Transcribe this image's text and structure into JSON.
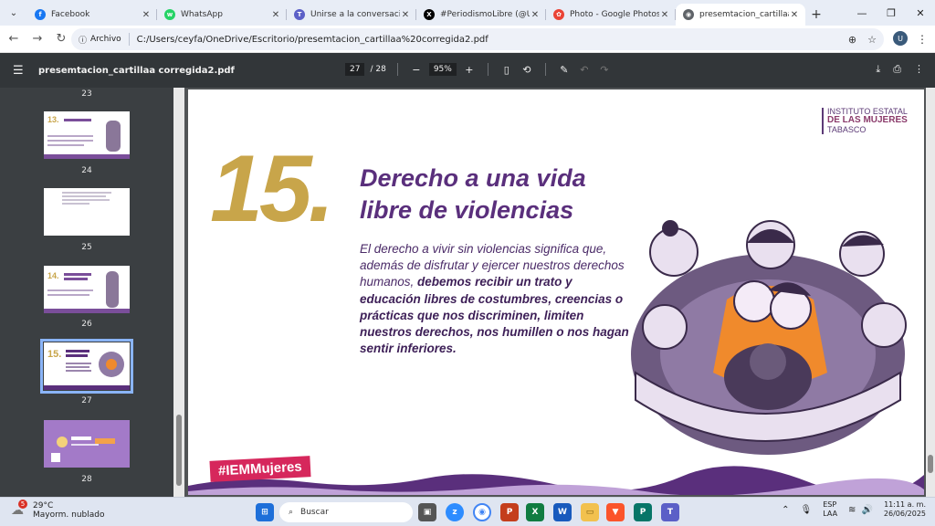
{
  "tabs": [
    {
      "title": "Facebook",
      "color": "#1877f2",
      "glyph": "f"
    },
    {
      "title": "WhatsApp",
      "color": "#25d366",
      "glyph": "w"
    },
    {
      "title": "Unirse a la conversación",
      "color": "#5b5fc7",
      "glyph": "T"
    },
    {
      "title": "#PeriodismoLibre (@UrielK",
      "color": "#000000",
      "glyph": "X"
    },
    {
      "title": "Photo - Google Photos",
      "color": "#ea4335",
      "glyph": "✿"
    },
    {
      "title": "presemtacion_cartillaa cor",
      "color": "#5f6368",
      "glyph": "◉",
      "active": true
    }
  ],
  "address": {
    "chip": "Archivo",
    "url": "C:/Users/ceyfa/OneDrive/Escritorio/presemtacion_cartillaa%20corregida2.pdf",
    "avatar": "U"
  },
  "pdf": {
    "filename": "presemtacion_cartillaa corregida2.pdf",
    "page": "27",
    "page_total": "/ 28",
    "zoom": "95%"
  },
  "thumbnails": [
    {
      "num": "23"
    },
    {
      "num": "24"
    },
    {
      "num": "25"
    },
    {
      "num": "26"
    },
    {
      "num": "27"
    },
    {
      "num": "28"
    }
  ],
  "slide": {
    "logo_l1": "INSTITUTO ESTATAL",
    "logo_l2": "DE LAS MUJERES",
    "logo_l3": "TABASCO",
    "number": "15.",
    "title_l1": "Derecho a una vida",
    "title_l2": "libre de violencias",
    "body_plain": "El derecho a vivir sin violencias significa que, además de disfrutar y ejercer nuestros derechos humanos, ",
    "body_bold": "debemos recibir un trato y educación libres de costumbres, creencias o prácticas que nos discriminen, limiten nuestros derechos, nos humillen o nos hagan sentir inferiores.",
    "hashtag": "#IEMMujeres",
    "colors": {
      "gold": "#c8a54a",
      "purple": "#5a2f7c",
      "pink": "#d6275c"
    }
  },
  "taskbar": {
    "temp": "29°C",
    "weather": "Mayorm. nublado",
    "weather_badge": "5",
    "search": "Buscar",
    "lang1": "ESP",
    "lang2": "LAA",
    "time": "11:11 a. m.",
    "date": "26/06/2025"
  }
}
